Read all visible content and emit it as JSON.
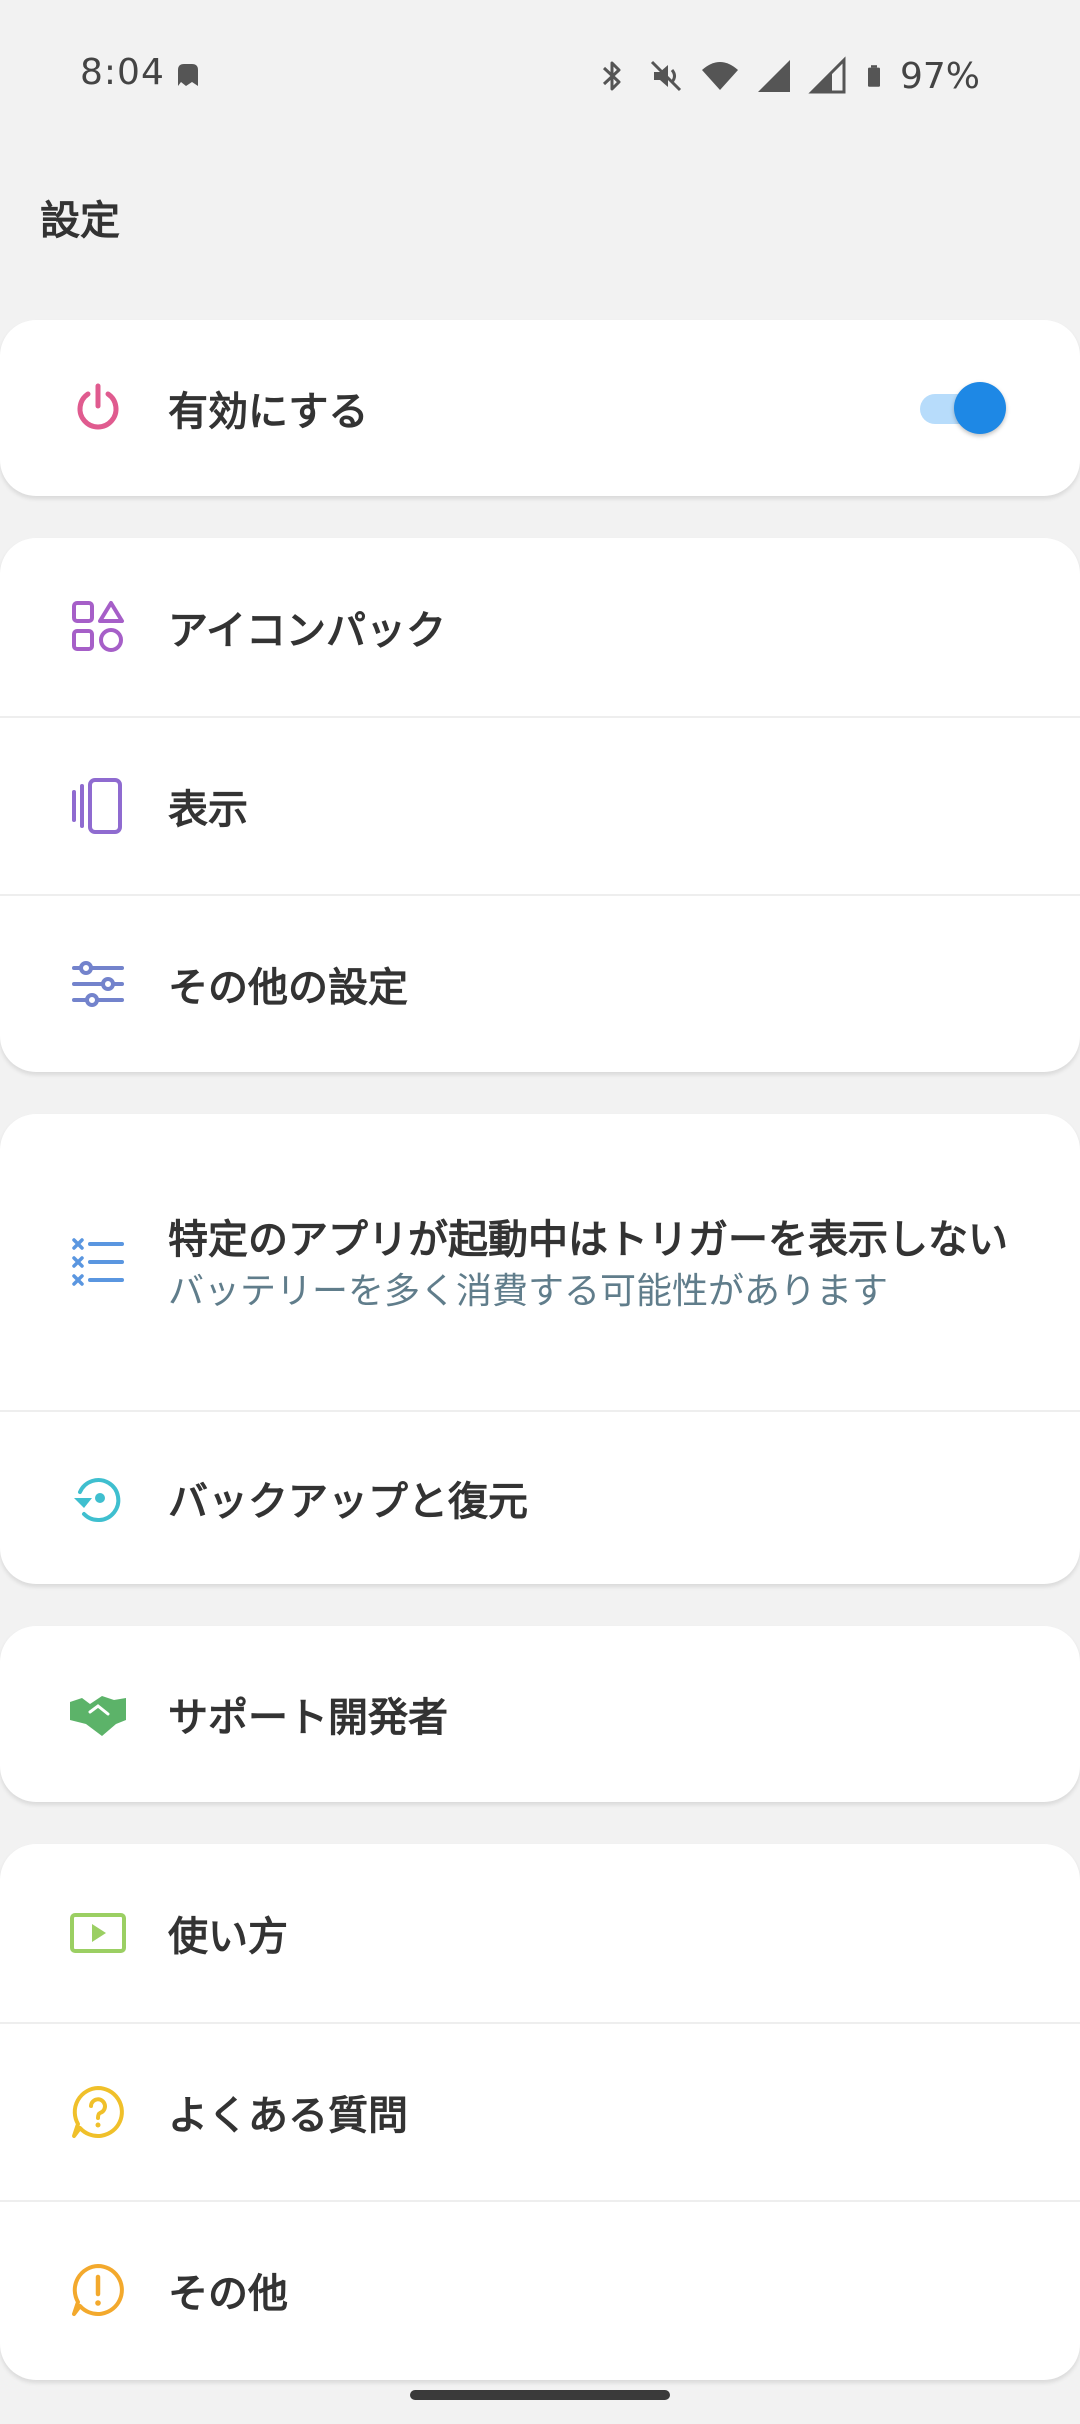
{
  "status_bar": {
    "time": "8:04",
    "battery": "97%"
  },
  "page": {
    "title": "設定"
  },
  "groups": [
    {
      "items": [
        {
          "label": "有効にする",
          "icon": "power-icon",
          "color": "#e05b8f",
          "toggle": true
        }
      ]
    },
    {
      "items": [
        {
          "label": "アイコンパック",
          "icon": "shapes-icon",
          "color": "#a65fc8"
        },
        {
          "label": "表示",
          "icon": "display-icon",
          "color": "#8f6bd0"
        },
        {
          "label": "その他の設定",
          "icon": "sliders-icon",
          "color": "#7383cc"
        }
      ]
    },
    {
      "items": [
        {
          "label": "特定のアプリが起動中はトリガーを表示しない",
          "sublabel": "バッテリーを多く消費する可能性があります",
          "icon": "checklist-icon",
          "color": "#5a96e0"
        },
        {
          "label": "バックアップと復元",
          "icon": "backup-restore-icon",
          "color": "#3fbfcf"
        }
      ]
    },
    {
      "items": [
        {
          "label": "サポート開発者",
          "icon": "handshake-icon",
          "color": "#5cb369"
        }
      ]
    },
    {
      "items": [
        {
          "label": "使い方",
          "icon": "play-video-icon",
          "color": "#9bcf63"
        },
        {
          "label": "よくある質問",
          "icon": "question-icon",
          "color": "#f0c02a"
        },
        {
          "label": "その他",
          "icon": "alert-icon",
          "color": "#f3a92d"
        }
      ]
    }
  ],
  "toggle_state": "on",
  "accent_color": "#1e88e5"
}
